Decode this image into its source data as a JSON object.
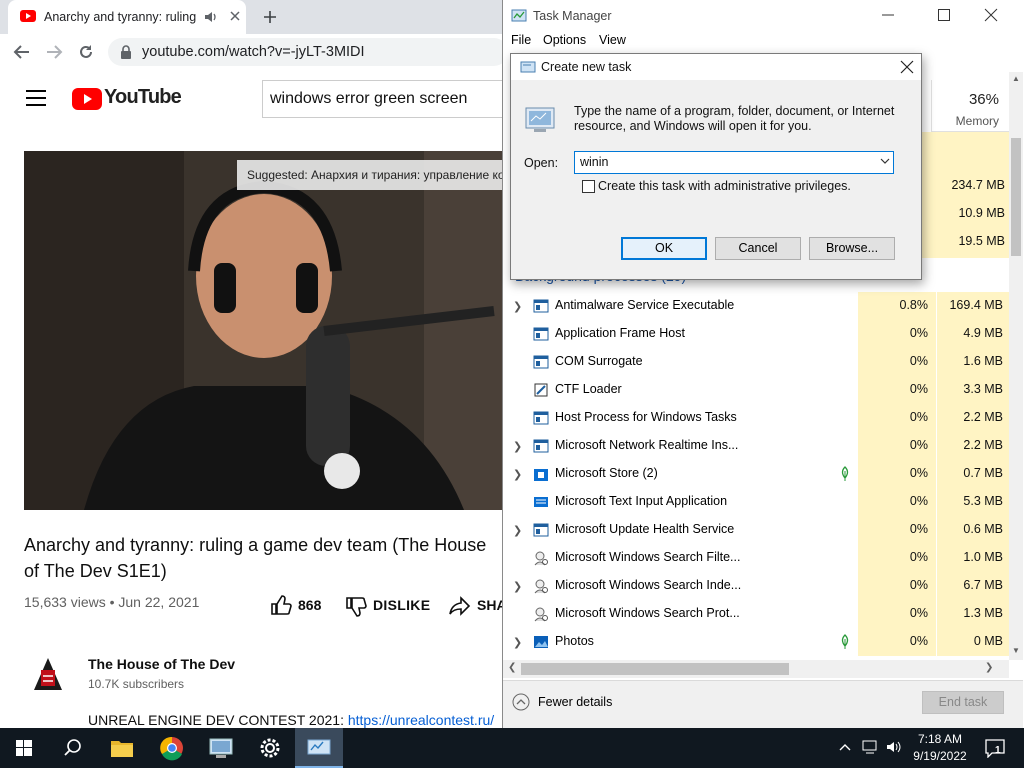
{
  "browser": {
    "tab_title": "Anarchy and tyranny: ruling",
    "url": "youtube.com/watch?v=-jyLT-3MIDI"
  },
  "youtube": {
    "logo_text": "YouTube",
    "search_value": "windows error green screen",
    "suggested": "Suggested: Анархия и тирания: управление ко",
    "video_title": "Anarchy and tyranny: ruling a game dev team (The House of The Dev S1E1)",
    "views_date": "15,633 views • Jun 22, 2021",
    "like_count": "868",
    "dislike_label": "DISLIKE",
    "share_label": "SHARE",
    "channel_name": "The House of The Dev",
    "channel_subs": "10.7K subscribers",
    "description_prefix": "UNREAL ENGINE DEV CONTEST 2021: ",
    "description_link": "https://unrealcontest.ru/"
  },
  "task_manager": {
    "title": "Task Manager",
    "menu": [
      "File",
      "Options",
      "View"
    ],
    "memory_percent": "36%",
    "memory_label": "Memory",
    "top_rows_mem": [
      "234.7 MB",
      "10.9 MB",
      "19.5 MB"
    ],
    "group_header": "Background processes (29)",
    "processes": [
      {
        "name": "Antimalware Service Executable",
        "cpu": "0.8%",
        "mem": "169.4 MB",
        "expand": true,
        "icon": "service-icon"
      },
      {
        "name": "Application Frame Host",
        "cpu": "0%",
        "mem": "4.9 MB",
        "expand": false,
        "icon": "service-icon"
      },
      {
        "name": "COM Surrogate",
        "cpu": "0%",
        "mem": "1.6 MB",
        "expand": false,
        "icon": "service-icon"
      },
      {
        "name": "CTF Loader",
        "cpu": "0%",
        "mem": "3.3 MB",
        "expand": false,
        "icon": "ctf-icon"
      },
      {
        "name": "Host Process for Windows Tasks",
        "cpu": "0%",
        "mem": "2.2 MB",
        "expand": false,
        "icon": "service-icon"
      },
      {
        "name": "Microsoft Network Realtime Ins...",
        "cpu": "0%",
        "mem": "2.2 MB",
        "expand": true,
        "icon": "service-icon"
      },
      {
        "name": "Microsoft Store (2)",
        "cpu": "0%",
        "mem": "0.7 MB",
        "expand": true,
        "icon": "store-icon",
        "leaf": true
      },
      {
        "name": "Microsoft Text Input Application",
        "cpu": "0%",
        "mem": "5.3 MB",
        "expand": false,
        "icon": "text-input-icon"
      },
      {
        "name": "Microsoft Update Health Service",
        "cpu": "0%",
        "mem": "0.6 MB",
        "expand": true,
        "icon": "service-icon"
      },
      {
        "name": "Microsoft Windows Search Filte...",
        "cpu": "0%",
        "mem": "1.0 MB",
        "expand": false,
        "icon": "search-user-icon"
      },
      {
        "name": "Microsoft Windows Search Inde...",
        "cpu": "0%",
        "mem": "6.7 MB",
        "expand": true,
        "icon": "search-user-icon"
      },
      {
        "name": "Microsoft Windows Search Prot...",
        "cpu": "0%",
        "mem": "1.3 MB",
        "expand": false,
        "icon": "search-user-icon"
      },
      {
        "name": "Photos",
        "cpu": "0%",
        "mem": "0 MB",
        "expand": true,
        "icon": "photos-icon",
        "leaf": true
      }
    ],
    "fewer_details": "Fewer details",
    "end_task": "End task"
  },
  "dialog": {
    "title": "Create new task",
    "description": "Type the name of a program, folder, document, or Internet resource, and Windows will open it for you.",
    "open_label": "Open:",
    "open_value": "winin",
    "admin_checkbox": "Create this task with administrative privileges.",
    "ok": "OK",
    "cancel": "Cancel",
    "browse": "Browse..."
  },
  "taskbar": {
    "time": "7:18 AM",
    "date": "9/19/2022",
    "notifications": "1"
  }
}
